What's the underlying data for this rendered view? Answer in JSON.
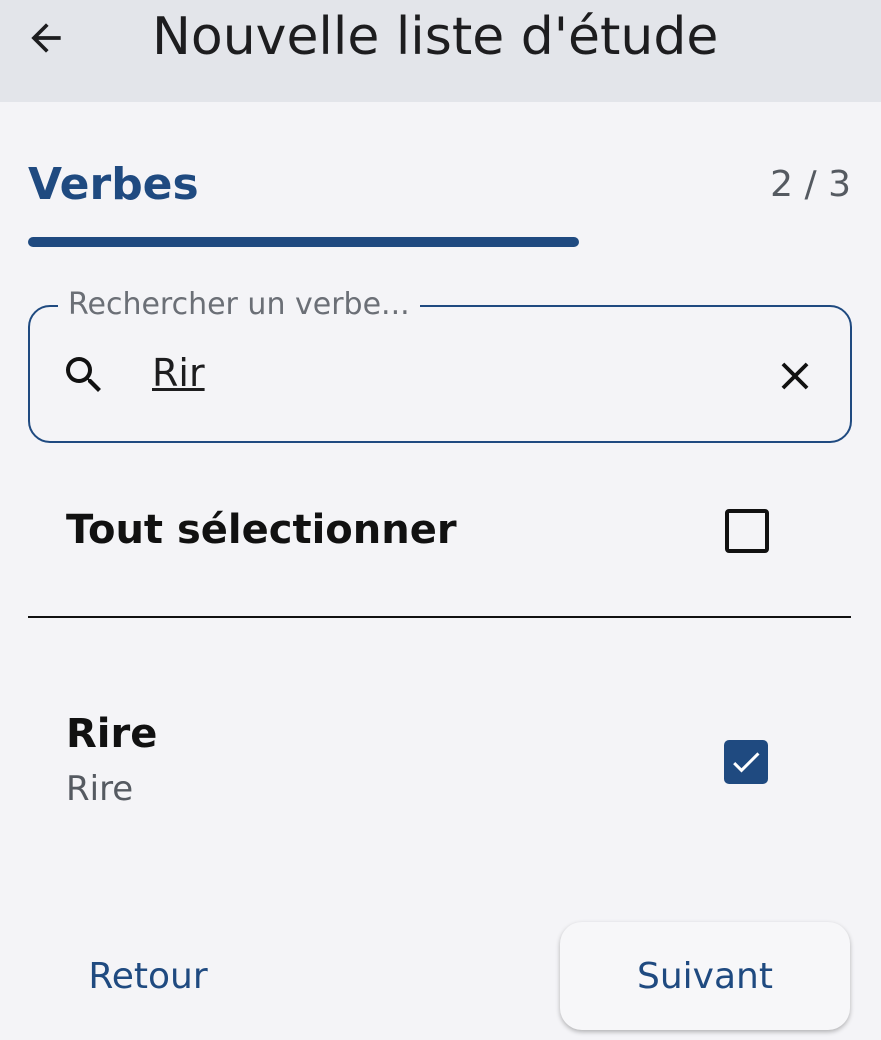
{
  "app_bar": {
    "title": "Nouvelle liste d'étude",
    "back_icon": "arrow-left-icon"
  },
  "section": {
    "title": "Verbes",
    "step": "2 / 3",
    "progress": 0.67
  },
  "search": {
    "label": "Rechercher un verbe...",
    "value": "Rir",
    "search_icon": "search-icon",
    "clear_icon": "close-icon"
  },
  "select_all": {
    "label": "Tout sélectionner",
    "checked": false
  },
  "verbs": [
    {
      "name": "Rire",
      "translation": "Rire",
      "checked": true
    }
  ],
  "footer": {
    "back_label": "Retour",
    "next_label": "Suivant"
  },
  "colors": {
    "accent": "#1f4a80",
    "app_bar_bg": "#e3e5ea",
    "page_bg": "#f4f4f7"
  }
}
